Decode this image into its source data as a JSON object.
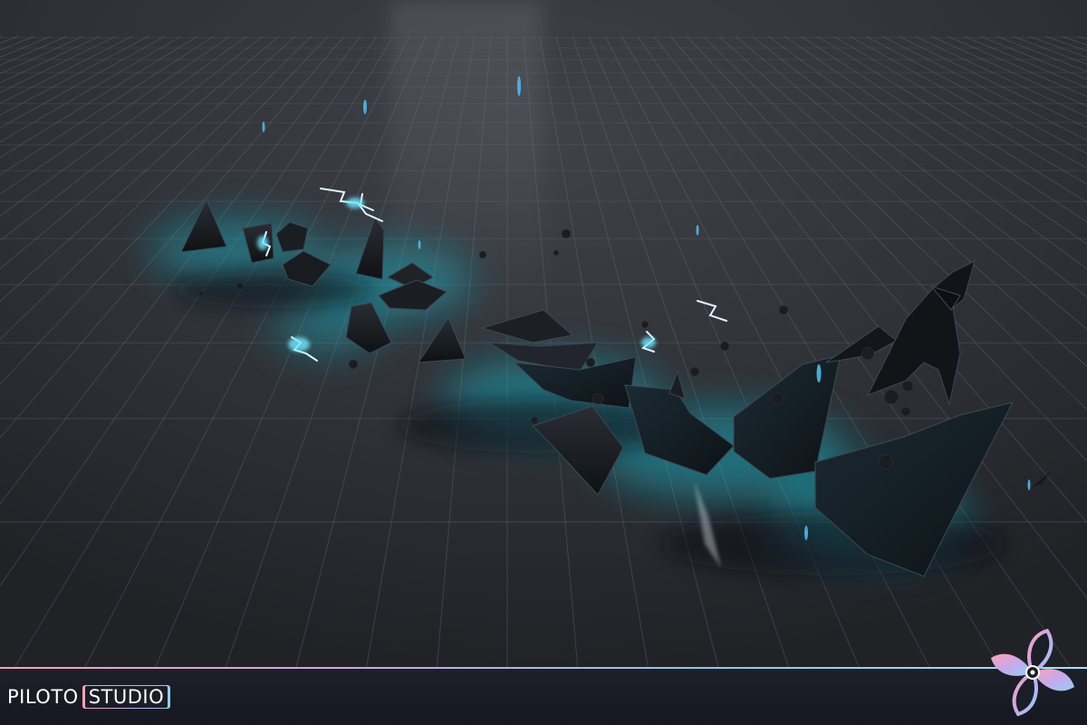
{
  "branding": {
    "logo_text_primary": "PILOTO",
    "logo_text_secondary": "STUDIO",
    "logo_mark_icon": "fan-blade-icon",
    "gradient_colors": [
      "#f6a3b4",
      "#c9a8ec",
      "#8fd0f0"
    ]
  },
  "scene": {
    "background_color": "#2c2e33",
    "grid_color": "#6d7380",
    "glow_color": "#19b9cf",
    "debris_color": "#17191d"
  }
}
